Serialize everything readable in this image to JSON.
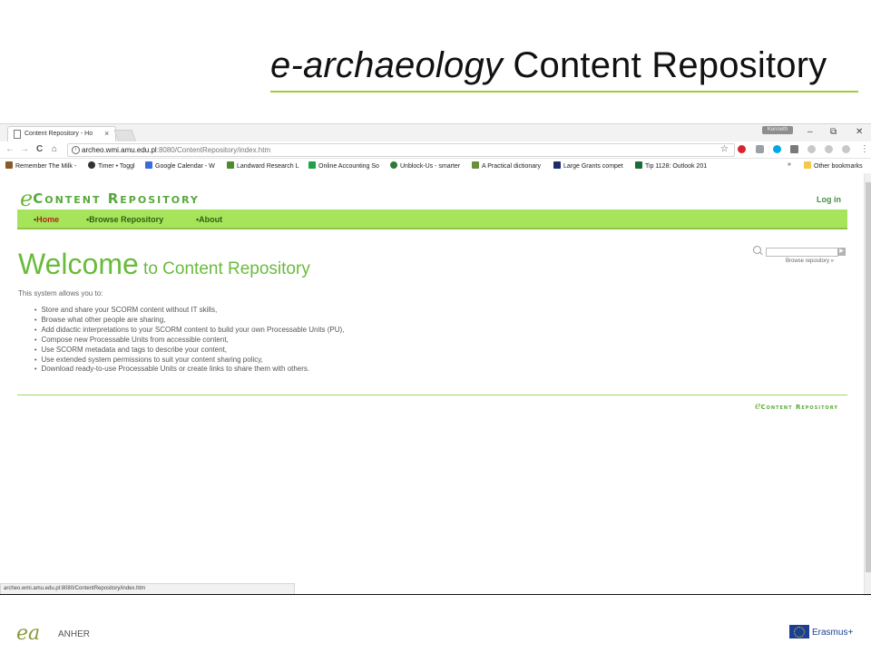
{
  "slide": {
    "title_italic": "e-archaeology",
    "title_rest": " Content Repository"
  },
  "browser": {
    "tab_title": "Content Repository - Ho",
    "tab_close": "×",
    "profile_label": "Kenneth",
    "window_controls": {
      "minimize": "–",
      "restore": "⧉",
      "close": "✕"
    },
    "nav": {
      "back": "←",
      "forward": "→",
      "reload": "C",
      "home": "⌂"
    },
    "url_host": "archeo.wmi.amu.edu.pl",
    "url_path": ":8080/ContentRepository/index.htm",
    "star": "☆",
    "bookmarks": [
      {
        "label": "Remember The Milk -",
        "icon": "cow-icon",
        "color": "#8a5a2b"
      },
      {
        "label": "Timer • Toggl",
        "icon": "toggl-icon",
        "color": "#333333"
      },
      {
        "label": "Google Calendar - W",
        "icon": "calendar-icon",
        "color": "#3b6bd6"
      },
      {
        "label": "Landward Research L",
        "icon": "landward-icon",
        "color": "#4f8a2f"
      },
      {
        "label": "Online Accounting So",
        "icon": "sage-icon",
        "color": "#1fa14a"
      },
      {
        "label": "Unblock-Us - smarter",
        "icon": "unblock-icon",
        "color": "#2d7a3a"
      },
      {
        "label": "A Practical dictionary",
        "icon": "dictionary-icon",
        "color": "#6a8f3a"
      },
      {
        "label": "Large Grants compet",
        "icon": "grants-icon",
        "color": "#1d2d6b"
      },
      {
        "label": "Tip 1128: Outlook 201",
        "icon": "outlook-icon",
        "color": "#1d6b3a"
      }
    ],
    "bookmarks_more": "»",
    "other_bookmarks": "Other bookmarks",
    "status_url": "archeo.wmi.amu.edu.pl:8080/ContentRepository/index.htm"
  },
  "page": {
    "logo_text": "Content Repository",
    "login_label": "Log in",
    "nav_items": [
      {
        "label": "Home",
        "active": true
      },
      {
        "label": "Browse Repository",
        "active": false
      },
      {
        "label": "About",
        "active": false
      }
    ],
    "search_go": "▶",
    "browse_link": "Browse repository »",
    "welcome_big": "Welcome",
    "welcome_small": " to Content Repository",
    "intro": "This system allows you to:",
    "bullets": [
      "Store and share your SCORM content without IT skills,",
      "Browse what other people are sharing,",
      "Add didactic interpretations to your SCORM content to build your own Processable Units (PU),",
      "Compose new Processable Units from accessible content,",
      "Use SCORM metadata and tags to describe your content,",
      "Use extended system permissions to suit your content sharing policy,",
      "Download ready-to-use Processable Units or create links to share them with others."
    ],
    "footer_logo_text": "Content Repository"
  },
  "footer": {
    "anher": "ANHER",
    "erasmus": "Erasmus+"
  }
}
